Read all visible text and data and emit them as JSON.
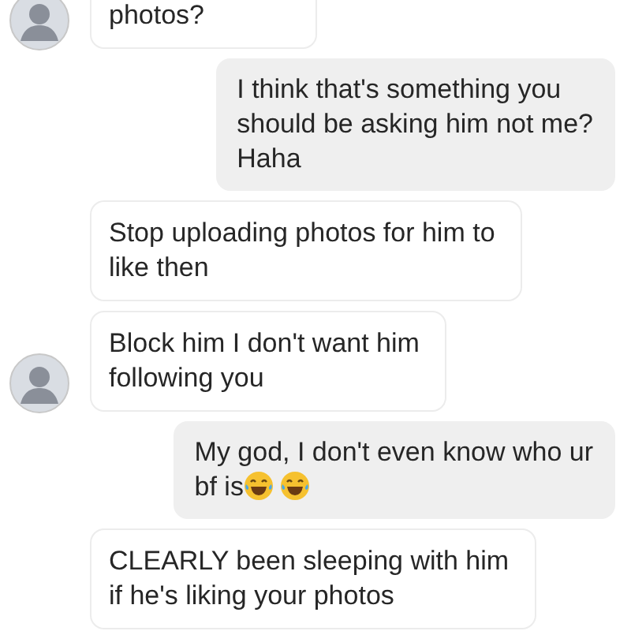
{
  "messages": [
    {
      "kind": "incoming",
      "avatar": true,
      "text": "photos?"
    },
    {
      "kind": "outgoing",
      "text": "I think that's something you\nshould be asking him not me?\nHaha"
    },
    {
      "kind": "incoming",
      "avatar": false,
      "text": "Stop uploading photos for him to\nlike then"
    },
    {
      "kind": "incoming",
      "avatar": true,
      "text": "Block him I don't want him\nfollowing you"
    },
    {
      "kind": "outgoing",
      "text": "My god, I don't even know who ur\nbf is",
      "emojis": [
        {
          "kind": "laugh"
        },
        {
          "kind": "laugh"
        }
      ]
    },
    {
      "kind": "incoming",
      "avatar": false,
      "text": "CLEARLY been sleeping with him\nif he's liking your photos"
    }
  ]
}
